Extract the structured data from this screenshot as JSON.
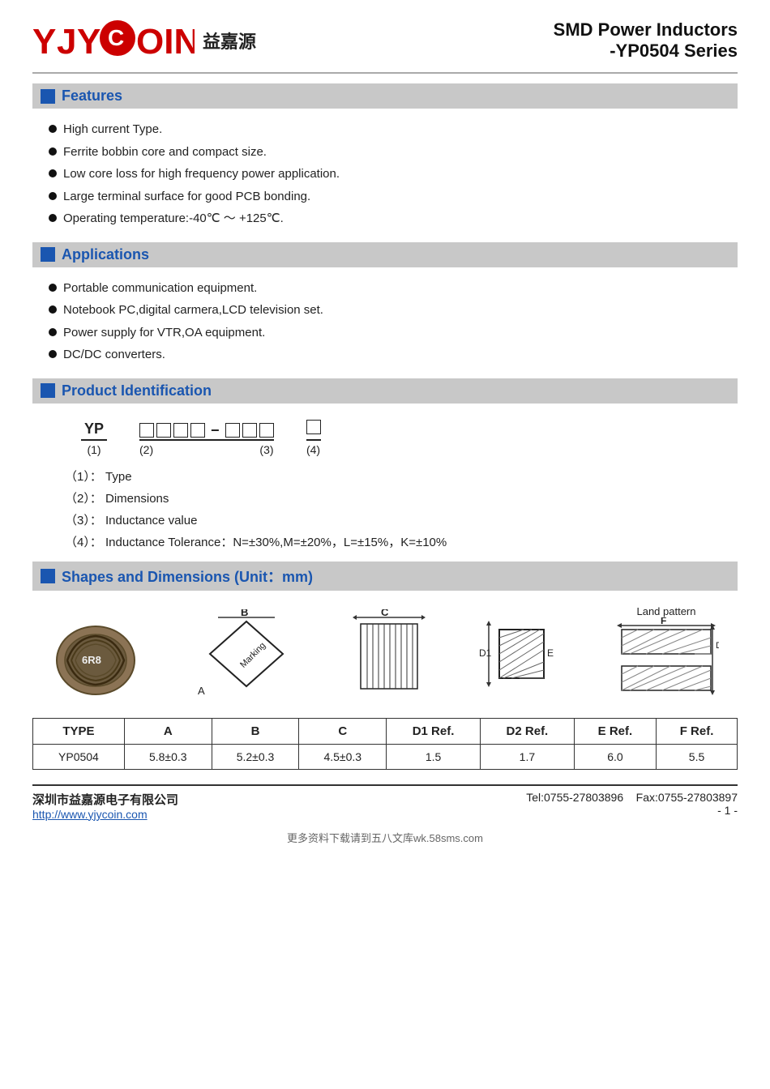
{
  "header": {
    "logo_yjy": "YJYCOIN",
    "logo_chinese": "益嘉源",
    "main_title": "SMD Power Inductors",
    "sub_title": "-YP0504 Series"
  },
  "features": {
    "section_title": "Features",
    "items": [
      "High current Type.",
      "Ferrite bobbin core and compact size.",
      "Low core loss for high frequency power application.",
      "Large terminal surface for good PCB bonding.",
      "Operating temperature:-40℃ ～ +125℃."
    ]
  },
  "applications": {
    "section_title": "Applications",
    "items": [
      "Portable communication equipment.",
      "Notebook PC,digital carmera,LCD television set.",
      "Power supply for VTR,OA equipment.",
      "DC/DC converters."
    ]
  },
  "product_identification": {
    "section_title": "Product Identification",
    "prefix": "YP",
    "prefix_label": "(1)",
    "boxes2_label": "(2)",
    "boxes3_label": "(3)",
    "box4_label": "(4)",
    "legends": [
      {
        "num": "（1）：",
        "desc": "Type"
      },
      {
        "num": "（2）：",
        "desc": "Dimensions"
      },
      {
        "num": "（3）：",
        "desc": "Inductance value"
      },
      {
        "num": "（4）：",
        "desc": "Inductance Tolerance：N=±30%,M=±20%，L=±15%，K=±10%"
      }
    ]
  },
  "shapes": {
    "section_title": "Shapes and Dimensions (Unit：mm)",
    "land_pattern_label": "Land pattern",
    "table": {
      "headers": [
        "TYPE",
        "A",
        "B",
        "C",
        "D1 Ref.",
        "D2 Ref.",
        "E Ref.",
        "F Ref."
      ],
      "rows": [
        [
          "YP0504",
          "5.8±0.3",
          "5.2±0.3",
          "4.5±0.3",
          "1.5",
          "1.7",
          "6.0",
          "5.5"
        ]
      ]
    }
  },
  "footer": {
    "company": "深圳市益嘉源电子有限公司",
    "tel": "Tel:0755-27803896",
    "fax": "Fax:0755-27803897",
    "website": "http://www.yjycoin.com",
    "page": "- 1 -",
    "bottom_text": "更多资料下载请到五八文库wk.58sms.com"
  }
}
